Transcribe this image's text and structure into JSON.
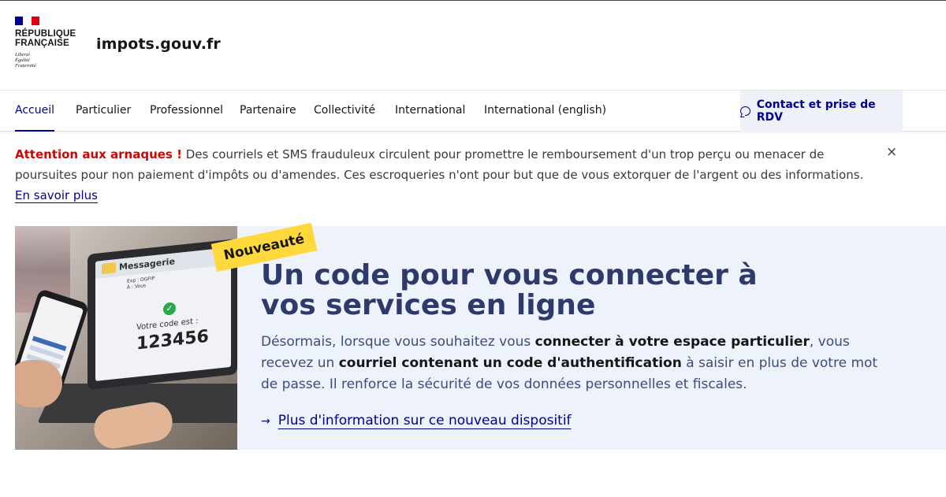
{
  "header": {
    "marianne_line1": "RÉPUBLIQUE",
    "marianne_line2": "FRANÇAISE",
    "devise_1": "Liberté",
    "devise_2": "Égalité",
    "devise_3": "Fraternité",
    "site_name": "impots.gouv.fr"
  },
  "nav": {
    "items": [
      {
        "label": "Accueil"
      },
      {
        "label": "Particulier"
      },
      {
        "label": "Professionnel"
      },
      {
        "label": "Partenaire"
      },
      {
        "label": "Collectivité"
      },
      {
        "label": "International"
      },
      {
        "label": "International (english)"
      }
    ],
    "contact_label": "Contact et prise de RDV"
  },
  "alert": {
    "title": "Attention aux arnaques !",
    "text": " Des courriels et SMS frauduleux circulent pour promettre le remboursement d'un trop perçu ou menacer de poursuites pour non paiement d'impôts ou d'amendes. Ces escroqueries n'ont pour but que de vous extorquer de l'argent ou des informations. ",
    "link": "En savoir plus",
    "close": "×"
  },
  "hero": {
    "badge": "Nouveauté",
    "image": {
      "mail_title": "Messagerie",
      "mail_from": "Exp : DGFIP",
      "mail_to": "À : Vous",
      "code_label": "Votre code est :",
      "code_value": "123456"
    },
    "title": "Un code pour vous connecter à vos services en ligne",
    "text_1": "Désormais, lorsque vous souhaitez vous ",
    "text_2": "connecter à votre espace particulier",
    "text_3": ", vous recevez un ",
    "text_4": "courriel contenant un code d'authentification",
    "text_5": " à saisir en plus de votre mot de passe. Il renforce la sécurité de vos données personnelles et fiscales.",
    "link": "Plus d'information sur ce nouveau dispositif"
  },
  "colors": {
    "brand_blue": "#000091",
    "alert_red": "#ce0500",
    "hero_bg": "#eef2fa",
    "badge_yellow": "#ffd93b"
  }
}
